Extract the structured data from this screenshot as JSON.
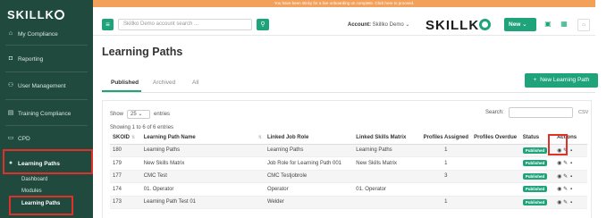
{
  "sidebar": {
    "logo_text": "SKILLK",
    "items": [
      {
        "label": "My Compliance",
        "icon": "home-icon"
      },
      {
        "label": "Reporting",
        "icon": "shield-icon"
      },
      {
        "label": "User Management",
        "icon": "users-icon"
      },
      {
        "label": "Training Compliance",
        "icon": "calendar-icon"
      },
      {
        "label": "CPD",
        "icon": "folder-icon"
      },
      {
        "label": "Learning Paths",
        "icon": "circle-icon"
      }
    ],
    "sub_items": [
      "Dashboard",
      "Modules",
      "Learning Paths"
    ]
  },
  "banner_text": "You have been sticky for a live onboarding on complete. Click here to proceed.",
  "header": {
    "search_placeholder": "Skillko Demo account search ...",
    "account_label": "Account:",
    "account_value": "Skillko Demo",
    "brand_text": "SKILLK",
    "new_label": "New"
  },
  "page_title": "Learning Paths",
  "tabs": [
    "Published",
    "Archived",
    "All"
  ],
  "new_button_label": "New Learning Path",
  "table_controls": {
    "show_label": "Show",
    "entries_value": "25",
    "entries_label": "entries",
    "search_label": "Search:",
    "csv_label": "CSV",
    "showing_text": "Showing 1 to 6 of 6 entries"
  },
  "columns": [
    "SKOID",
    "Learning Path Name",
    "Linked Job Role",
    "Linked Skills Matrix",
    "Profiles Assigned",
    "Profiles Overdue",
    "Status",
    "Actions"
  ],
  "rows": [
    {
      "id": "180",
      "name": "Learning Paths",
      "role": "Learning Paths",
      "matrix": "Learning Paths",
      "assigned": "1",
      "overdue": "",
      "status": "Published"
    },
    {
      "id": "179",
      "name": "New Skills Matrix",
      "role": "Job Role for Learning Path 001",
      "matrix": "New Skills Matrix",
      "assigned": "1",
      "overdue": "",
      "status": "Published"
    },
    {
      "id": "177",
      "name": "CMC Test",
      "role": "CMC Testjobrole",
      "matrix": "",
      "assigned": "3",
      "overdue": "",
      "status": "Published"
    },
    {
      "id": "174",
      "name": "01. Operator",
      "role": "Operator",
      "matrix": "01. Operator",
      "assigned": "",
      "overdue": "",
      "status": "Published"
    },
    {
      "id": "173",
      "name": "Learning Path Test 01",
      "role": "Welder",
      "matrix": "",
      "assigned": "1",
      "overdue": "",
      "status": "Published"
    }
  ],
  "colors": {
    "accent": "#1fa37a",
    "sidebar": "#1f4a3d",
    "highlight": "#e0302a"
  }
}
